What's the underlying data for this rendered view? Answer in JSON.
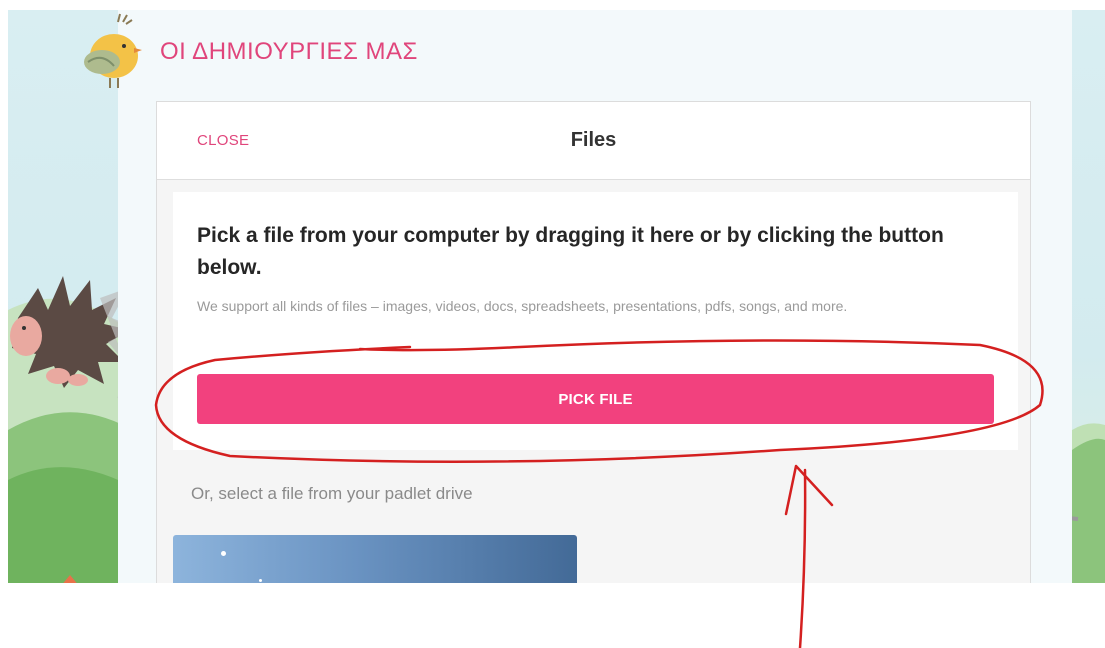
{
  "board": {
    "title": "ΟΙ ΔΗΜΙΟΥΡΓΙΕΣ ΜΑΣ"
  },
  "modal": {
    "close_label": "CLOSE",
    "title": "Files",
    "drop_heading": "Pick a file from your computer by dragging it here or by clicking the button below.",
    "drop_subtext": "We support all kinds of files – images, videos, docs, spreadsheets, presentations, pdfs, songs, and more.",
    "pick_button_label": "PICK FILE",
    "drive_label": "Or, select a file from your padlet drive"
  },
  "colors": {
    "accent": "#f2417e",
    "title_pink": "#e0457b",
    "annotation_red": "#d42020"
  },
  "icons": {
    "bird": "bird-illustration",
    "hedgehog": "hedgehog-illustration"
  }
}
